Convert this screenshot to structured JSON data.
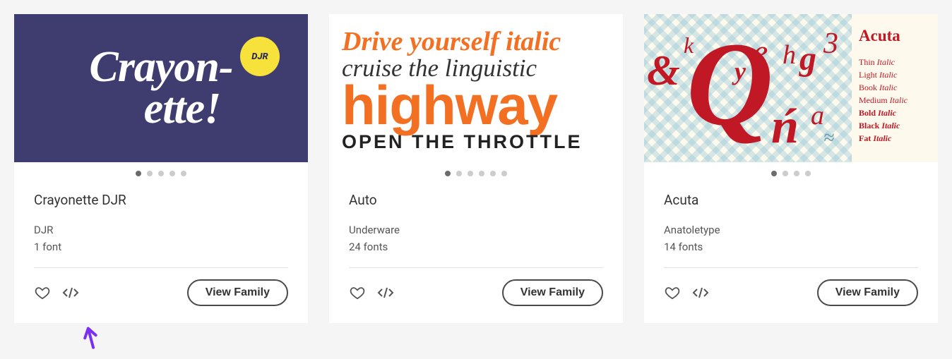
{
  "cards": [
    {
      "preview": {
        "line1": "Crayon-",
        "line2": "ette!",
        "badge": "DJR"
      },
      "dots": 5,
      "activeDot": 0,
      "name": "Crayonette DJR",
      "foundry": "DJR",
      "count": "1 font",
      "viewLabel": "View Family"
    },
    {
      "preview": {
        "l1": "Drive yourself italic",
        "l2": "cruise the linguistic",
        "l3": "highway",
        "l4": "OPEN THE THROTTLE"
      },
      "dots": 6,
      "activeDot": 0,
      "name": "Auto",
      "foundry": "Underware",
      "count": "24 fonts",
      "viewLabel": "View Family"
    },
    {
      "preview": {
        "title": "Acuta",
        "glyphs": {
          "amp": "&",
          "k": "k",
          "y": "y",
          "e": "e",
          "h": "h",
          "g": "g",
          "three": "3",
          "Q": "Q",
          "n": "ń",
          "a": "a",
          "tilde": "≈"
        },
        "weights": [
          {
            "w": "Thin",
            "s": "Italic",
            "cls": ""
          },
          {
            "w": "Light",
            "s": "Italic",
            "cls": ""
          },
          {
            "w": "Book",
            "s": "Italic",
            "cls": ""
          },
          {
            "w": "Medium",
            "s": "Italic",
            "cls": ""
          },
          {
            "w": "Bold",
            "s": "Italic",
            "cls": "wbold"
          },
          {
            "w": "Black",
            "s": "Italic",
            "cls": "wblack"
          },
          {
            "w": "Fat",
            "s": "Italic",
            "cls": "wblack"
          }
        ]
      },
      "dots": 4,
      "activeDot": 0,
      "name": "Acuta",
      "foundry": "Anatoletype",
      "count": "14 fonts",
      "viewLabel": "View Family"
    }
  ]
}
